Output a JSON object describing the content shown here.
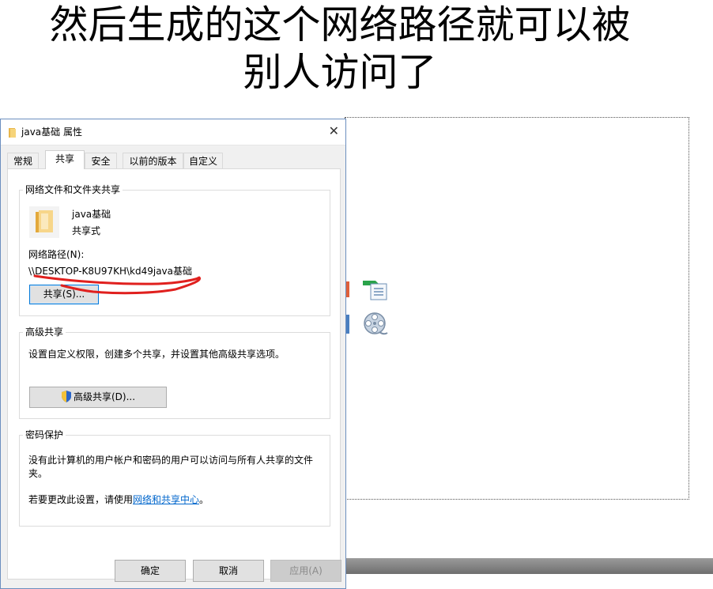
{
  "caption": {
    "line1": "然后生成的这个网络路径就可以被",
    "line2": "别人访问了"
  },
  "dialog": {
    "title": "java基础 属性",
    "tabs": [
      "常规",
      "共享",
      "安全",
      "以前的版本",
      "自定义"
    ],
    "active_tab": "共享",
    "network_sharing": {
      "group_title": "网络文件和文件夹共享",
      "folder_name": "java基础",
      "share_state": "共享式",
      "path_label": "网络路径(N):",
      "path_value": "\\\\DESKTOP-K8U97KH\\kd49java基础",
      "share_button": "共享(S)..."
    },
    "advanced_sharing": {
      "group_title": "高级共享",
      "description": "设置自定义权限，创建多个共享，并设置其他高级共享选项。",
      "button": "高级共享(D)..."
    },
    "password_protection": {
      "group_title": "密码保护",
      "description_line1": "没有此计算机的用户帐户和密码的用户可以访问与所有人共享的文件",
      "description_line2": "夹。",
      "change_prefix": "若要更改此设置，请使用",
      "change_link": "网络和共享中心",
      "change_suffix": "。"
    },
    "footer": {
      "ok": "确定",
      "cancel": "取消",
      "apply": "应用(A)"
    }
  },
  "colors": {
    "annotation_underline": "#e0201e",
    "link": "#0066cc",
    "focus_border": "#0078d7"
  },
  "icons": [
    "folder-icon",
    "close-icon",
    "shared-folder-icon",
    "uac-shield-icon",
    "green-document-icon",
    "film-reel-icon"
  ]
}
